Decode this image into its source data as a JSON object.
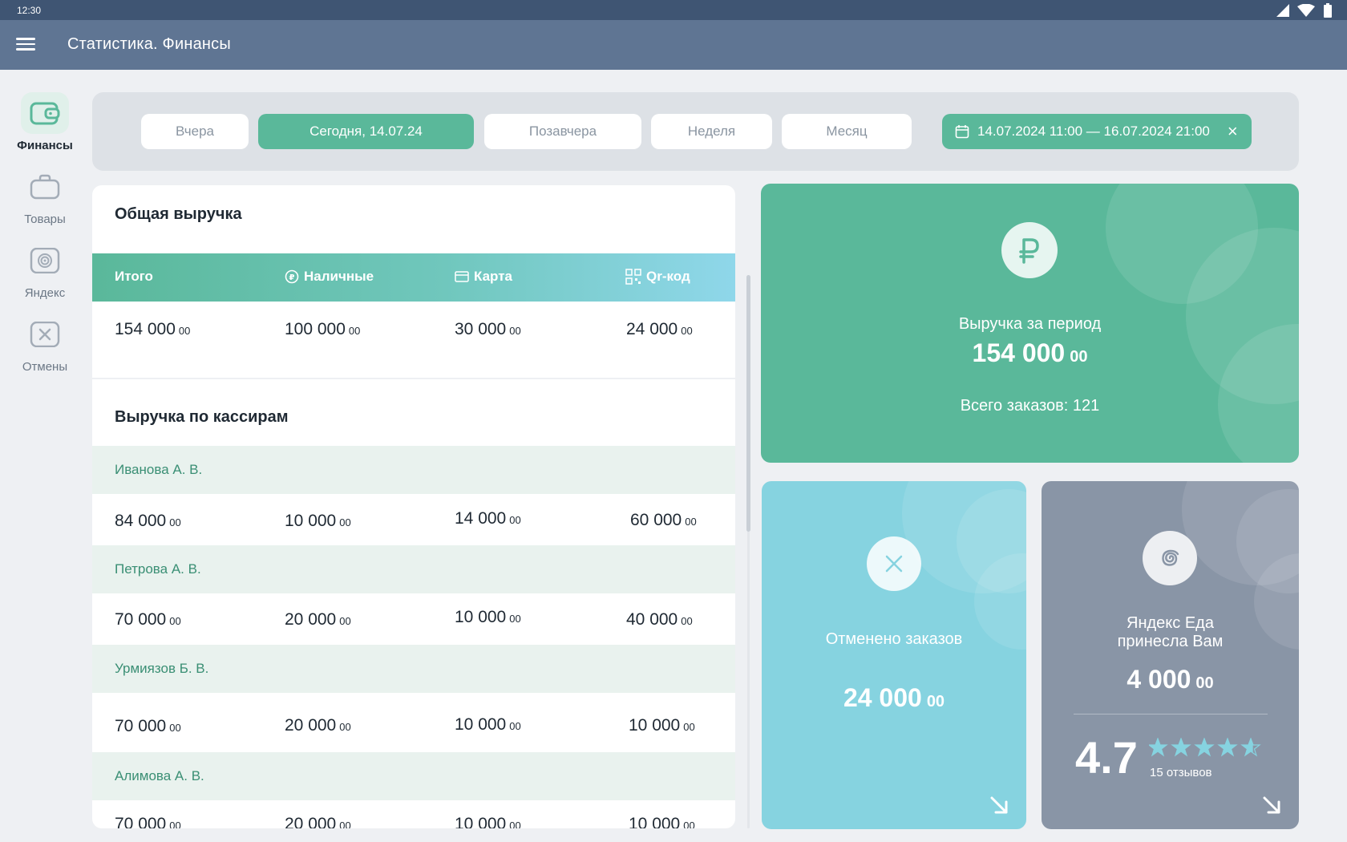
{
  "status_bar": {
    "time": "12:30"
  },
  "app_bar": {
    "title": "Статистика. Финансы"
  },
  "sidebar": {
    "items": [
      {
        "label": "Финансы",
        "icon": "wallet-icon",
        "active": true
      },
      {
        "label": "Товары",
        "icon": "briefcase-icon",
        "active": false
      },
      {
        "label": "Яндекс",
        "icon": "spiral-icon",
        "active": false
      },
      {
        "label": "Отмены",
        "icon": "cancel-box-icon",
        "active": false
      }
    ]
  },
  "filters": {
    "chips": [
      "Вчера",
      "Сегодня, 14.07.24",
      "Позавчера",
      "Неделя",
      "Месяц"
    ],
    "active_chip": "Сегодня, 14.07.24",
    "range": "14.07.2024 11:00 — 16.07.2024 21:00"
  },
  "total_revenue": {
    "title": "Общая выручка",
    "columns": [
      "Итого",
      "Наличные",
      "Карта",
      "Qr-код"
    ],
    "values": [
      {
        "int": "154 000",
        "dec": "00"
      },
      {
        "int": "100 000",
        "dec": "00"
      },
      {
        "int": "30 000",
        "dec": "00"
      },
      {
        "int": "24 000",
        "dec": "00"
      }
    ]
  },
  "cashiers": {
    "title": "Выручка по кассирам",
    "rows": [
      {
        "name": "Иванова А. В.",
        "values": [
          {
            "int": "84 000",
            "dec": "00"
          },
          {
            "int": "10 000",
            "dec": "00"
          },
          {
            "int": "14 000",
            "dec": "00"
          },
          {
            "int": "60 000",
            "dec": "00"
          }
        ]
      },
      {
        "name": "Петрова А. В.",
        "values": [
          {
            "int": "70 000",
            "dec": "00"
          },
          {
            "int": "20 000",
            "dec": "00"
          },
          {
            "int": "10 000",
            "dec": "00"
          },
          {
            "int": "40 000",
            "dec": "00"
          }
        ]
      },
      {
        "name": "Урмиязов Б. В.",
        "values": [
          {
            "int": "70 000",
            "dec": "00"
          },
          {
            "int": "20 000",
            "dec": "00"
          },
          {
            "int": "10 000",
            "dec": "00"
          },
          {
            "int": "10 000",
            "dec": "00"
          }
        ]
      },
      {
        "name": "Алимова А. В.",
        "values": [
          {
            "int": "70 000",
            "dec": "00"
          },
          {
            "int": "20 000",
            "dec": "00"
          },
          {
            "int": "10 000",
            "dec": "00"
          },
          {
            "int": "10 000",
            "dec": "00"
          }
        ]
      }
    ]
  },
  "period_card": {
    "label": "Выручка за период",
    "amount_int": "154 000",
    "amount_dec": "00",
    "orders_text": "Всего заказов: 121",
    "icon": "ruble-icon",
    "color": "#5ab89a"
  },
  "cancel_card": {
    "label": "Отменено заказов",
    "amount_int": "24 000",
    "amount_dec": "00",
    "icon": "close-icon",
    "color": "#86d3e0"
  },
  "yandex_card": {
    "label_line1": "Яндекс Еда",
    "label_line2": "принесла Вам",
    "amount_int": "4 000",
    "amount_dec": "00",
    "rating": "4.7",
    "reviews": "15 отзывов",
    "stars_filled_fraction": 0.94,
    "icon": "spiral-icon",
    "color": "#8995a6"
  },
  "colors": {
    "accent": "#5ab89a",
    "appbar": "#5f7593",
    "statusbar": "#3f5573",
    "cashier_name": "#3a8f74"
  }
}
